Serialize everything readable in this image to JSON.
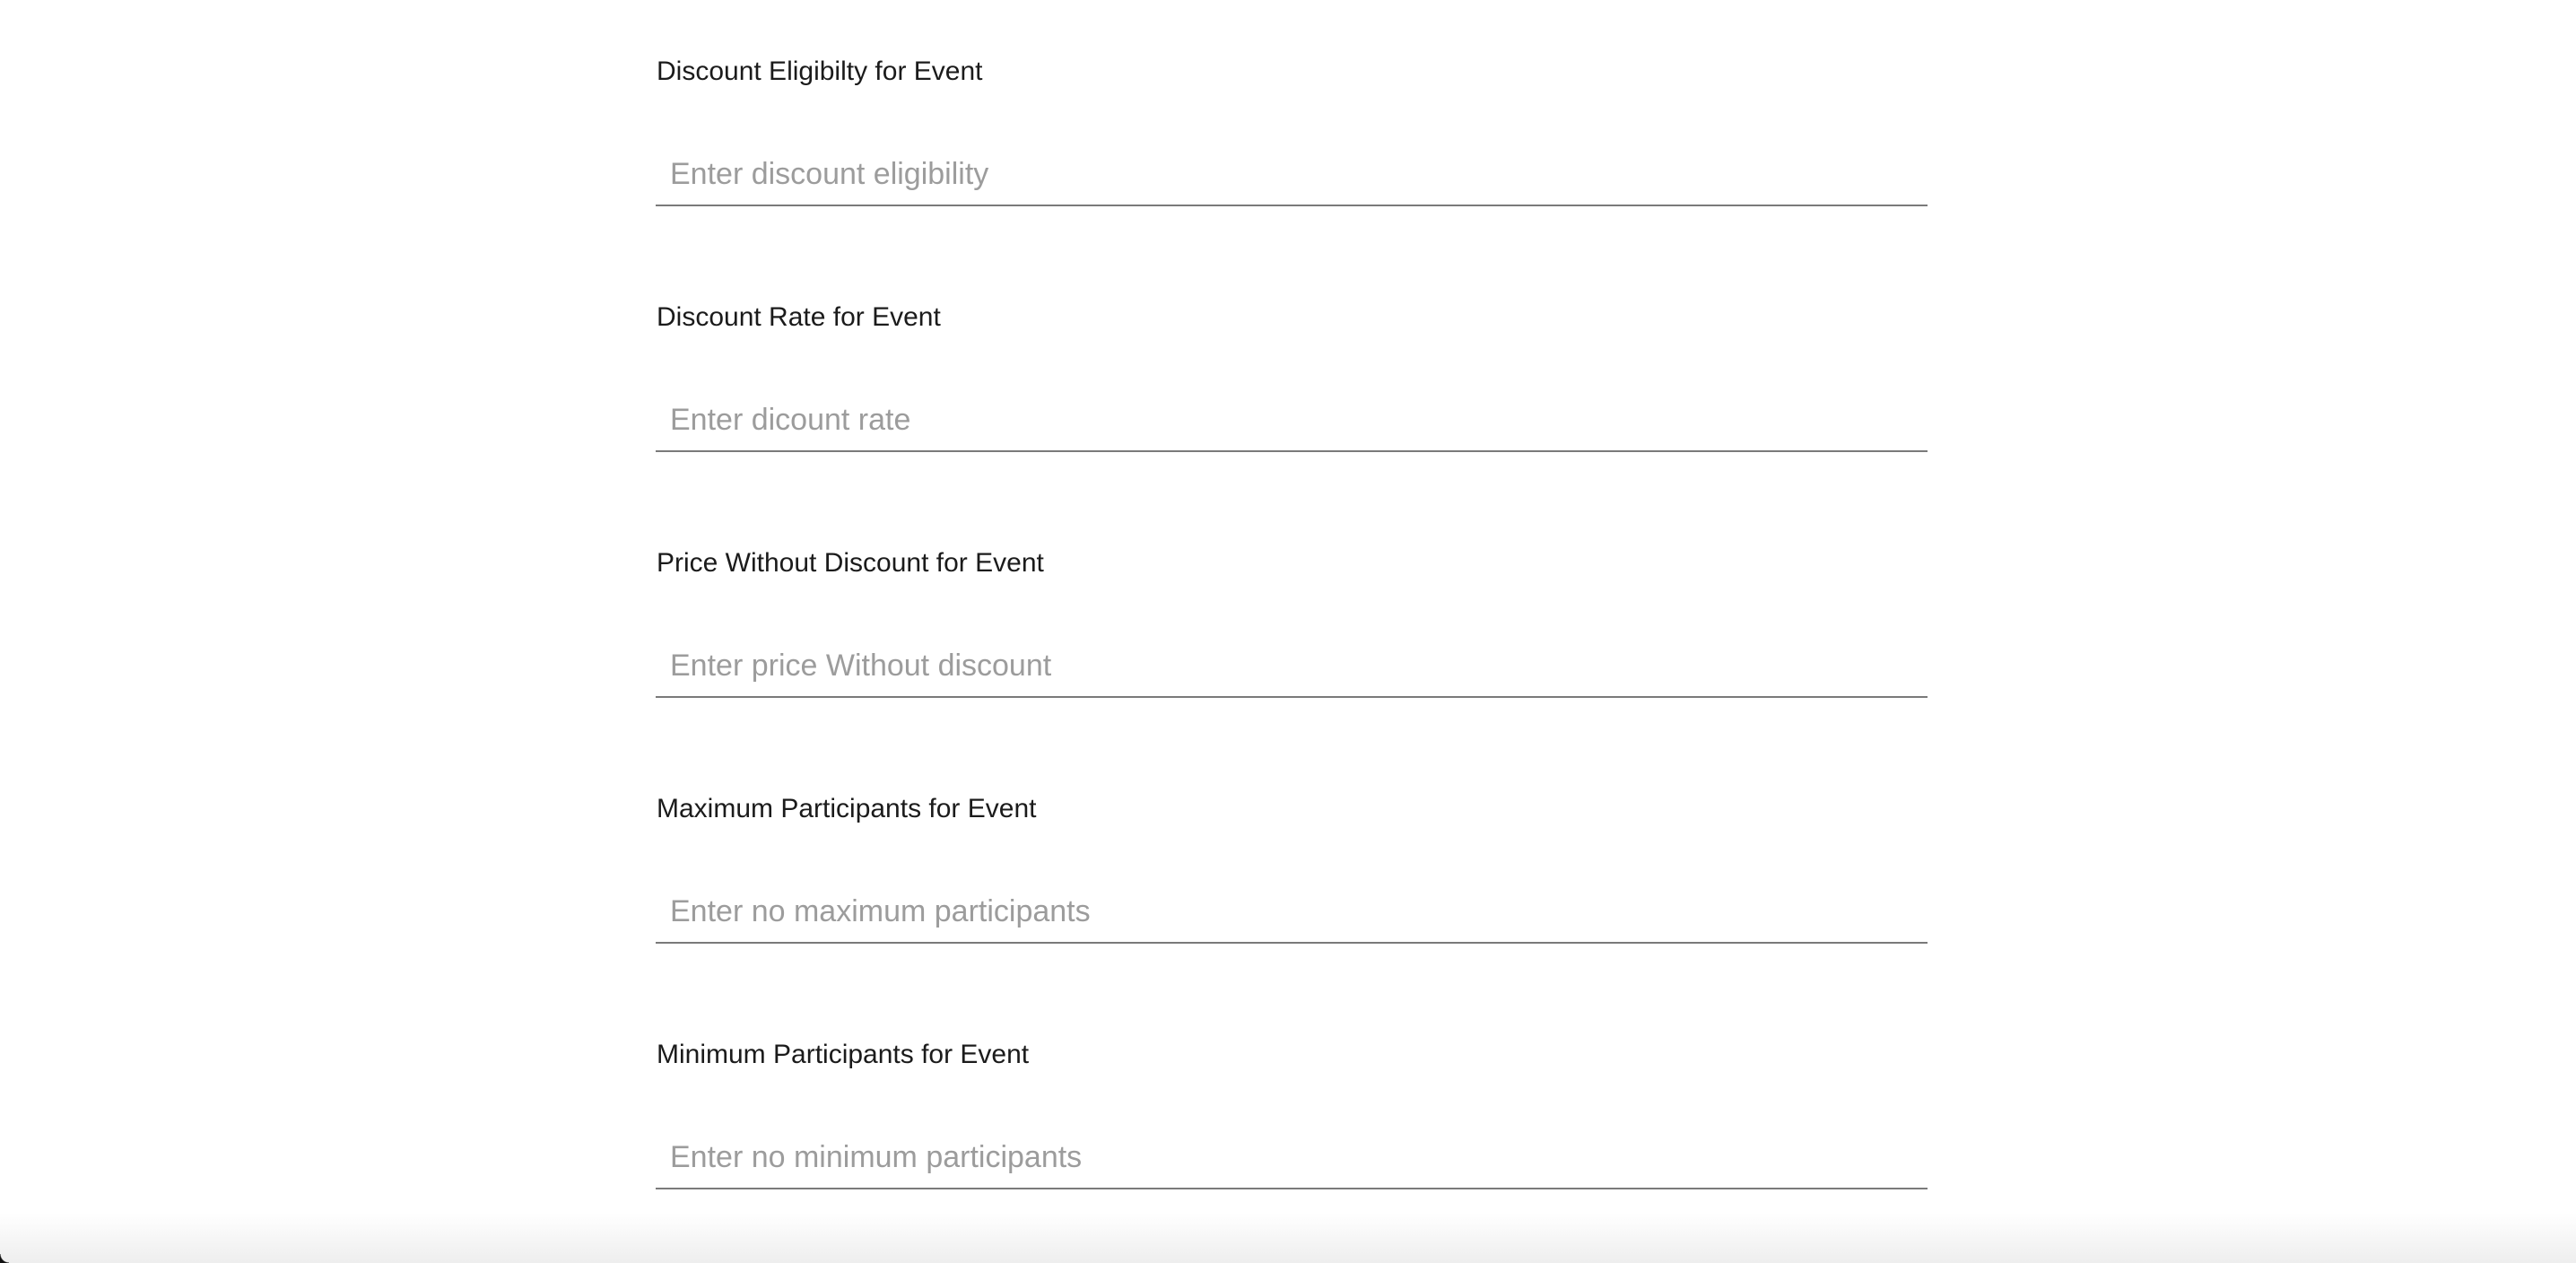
{
  "form": {
    "fields": [
      {
        "label": "Discount Eligibilty for Event",
        "placeholder": "Enter discount eligibility",
        "value": ""
      },
      {
        "label": "Discount Rate for Event",
        "placeholder": "Enter dicount rate",
        "value": ""
      },
      {
        "label": "Price Without Discount for Event",
        "placeholder": "Enter price Without discount",
        "value": ""
      },
      {
        "label": "Maximum Participants for Event",
        "placeholder": "Enter no maximum participants",
        "value": ""
      },
      {
        "label": "Minimum Participants for Event",
        "placeholder": "Enter no minimum participants",
        "value": ""
      }
    ]
  },
  "colors": {
    "background": "#ffffff",
    "label_text": "#1b1b1b",
    "placeholder_text": "#9c9c9c",
    "underline": "#7a7a7a"
  }
}
